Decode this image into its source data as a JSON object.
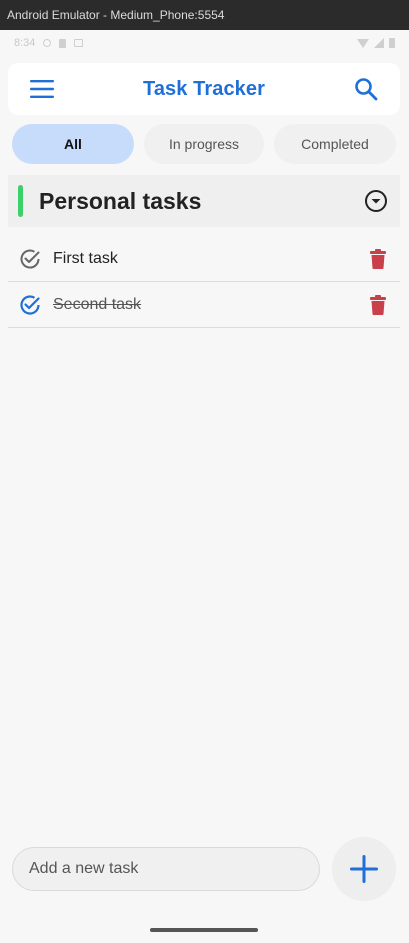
{
  "window": {
    "title": "Android Emulator - Medium_Phone:5554"
  },
  "status_bar": {
    "time": "8:34"
  },
  "app_bar": {
    "title": "Task Tracker",
    "menu_icon": "menu-icon",
    "search_icon": "search-icon"
  },
  "filters": [
    {
      "label": "All",
      "selected": true
    },
    {
      "label": "In progress",
      "selected": false
    },
    {
      "label": "Completed",
      "selected": false
    }
  ],
  "section": {
    "title": "Personal tasks",
    "accent_color": "#3ccf6a",
    "toggle_icon": "chevron-down-circle-icon"
  },
  "tasks": [
    {
      "label": "First task",
      "completed": false
    },
    {
      "label": "Second task",
      "completed": true
    }
  ],
  "new_task": {
    "placeholder": "Add a new task",
    "value": ""
  },
  "colors": {
    "primary": "#1f6fd8",
    "delete": "#c9404a",
    "chip_active": "#c7dcfb"
  }
}
